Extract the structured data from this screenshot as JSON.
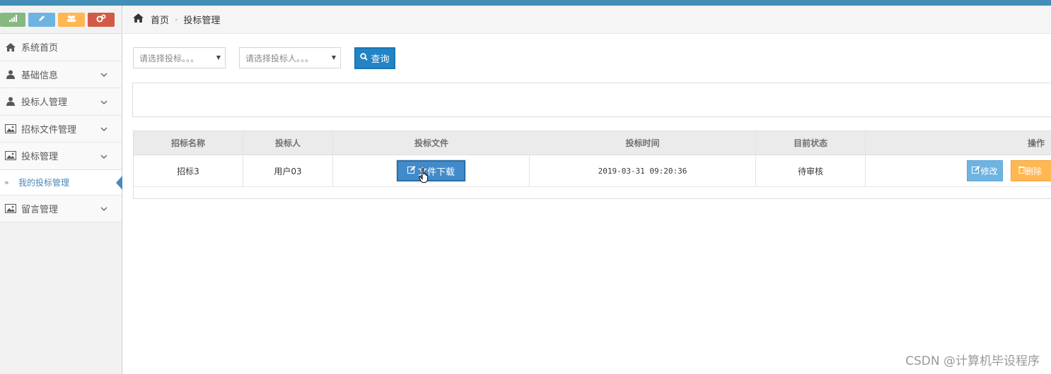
{
  "shortcuts": {
    "stats_icon": "bar-chart-icon",
    "edit_icon": "pencil-icon",
    "users_icon": "group-icon",
    "settings_icon": "cogs-icon",
    "colors": [
      "#87b87f",
      "#6fb3e0",
      "#ffb752",
      "#d15b47"
    ]
  },
  "sidebar": {
    "items": [
      {
        "label": "系统首页",
        "icon": "home-icon",
        "has_arrow": false
      },
      {
        "label": "基础信息",
        "icon": "user-icon",
        "has_arrow": true
      },
      {
        "label": "投标人管理",
        "icon": "user-icon",
        "has_arrow": true
      },
      {
        "label": "招标文件管理",
        "icon": "picture-icon",
        "has_arrow": true
      },
      {
        "label": "投标管理",
        "icon": "picture-icon",
        "has_arrow": true
      },
      {
        "label": "留言管理",
        "icon": "picture-icon",
        "has_arrow": true
      }
    ],
    "submenu": {
      "label": "我的投标管理",
      "active": true
    }
  },
  "breadcrumb": {
    "home": "首页",
    "current": "投标管理"
  },
  "filters": {
    "tender_select": "请选择投标。。。",
    "bidder_select": "请选择投标人。。。",
    "search_button": "查询"
  },
  "table": {
    "headers": [
      "招标名称",
      "投标人",
      "投标文件",
      "投标时间",
      "目前状态",
      "操作"
    ],
    "rows": [
      {
        "tender_name": "招标3",
        "bidder": "用户03",
        "file_button": "文件下载",
        "bid_time": "2019-03-31 09:20:36",
        "status": "待审核",
        "edit_button": "修改",
        "delete_button": "删除"
      }
    ]
  },
  "watermark": "CSDN @计算机毕设程序",
  "colors": {
    "accent": "#438eb9",
    "primary_button": "#2283c5",
    "edit_button": "#6fb3e0",
    "delete_button": "#ffb752",
    "active_link": "#4b88b7"
  }
}
